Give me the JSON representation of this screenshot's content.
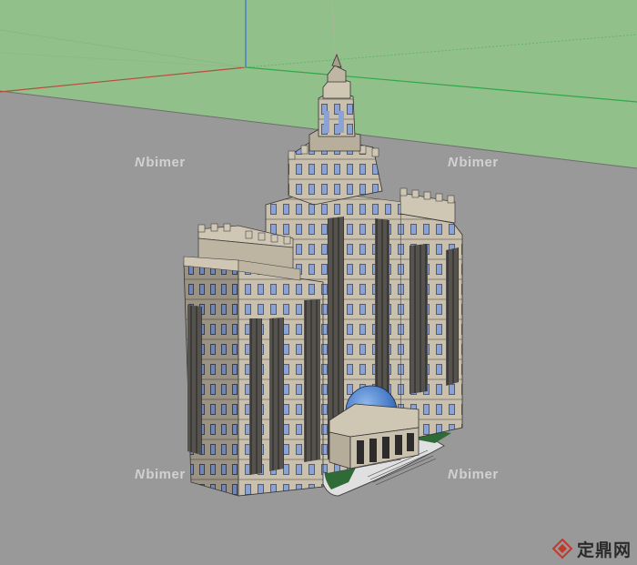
{
  "watermarks": [
    {
      "text": "bimer"
    },
    {
      "text": "bimer"
    },
    {
      "text": "bimer"
    },
    {
      "text": "bimer"
    }
  ],
  "brand": {
    "logo_icon": "diamond-logo-icon",
    "text": "定鼎网"
  },
  "colors": {
    "sky": "#92c08a",
    "ground": "#9a999a",
    "stone": "#cfc6b4",
    "shadow_stone": "#8d877b",
    "window": "#7f9ad0",
    "dome": "#4d82cc",
    "axis_red": "#b94a3a",
    "axis_green": "#2fa848",
    "axis_blue": "#3a6fd8"
  }
}
